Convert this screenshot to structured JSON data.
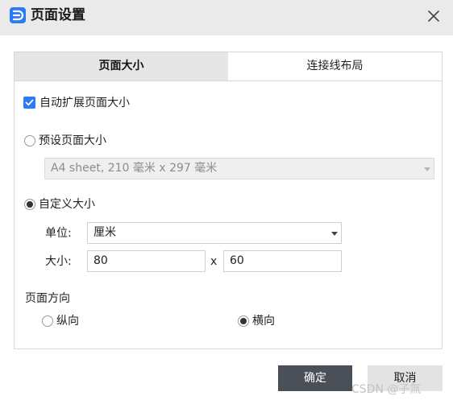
{
  "window": {
    "title": "页面设置"
  },
  "tabs": [
    {
      "label": "页面大小",
      "active": true
    },
    {
      "label": "连接线布局",
      "active": false
    }
  ],
  "auto_expand": {
    "label": "自动扩展页面大小",
    "checked": true
  },
  "preset": {
    "label": "预设页面大小",
    "selected": false,
    "dropdown_value": "A4 sheet, 210 毫米 x 297 毫米"
  },
  "custom": {
    "label": "自定义大小",
    "selected": true,
    "unit_label": "单位:",
    "unit_value": "厘米",
    "size_label": "大小:",
    "width_value": "80",
    "separator": "x",
    "height_value": "60"
  },
  "orientation": {
    "title": "页面方向",
    "portrait": {
      "label": "纵向",
      "selected": false
    },
    "landscape": {
      "label": "横向",
      "selected": true
    }
  },
  "buttons": {
    "ok": "确定",
    "cancel": "取消"
  },
  "watermark": "CSDN @子氚",
  "colors": {
    "accent": "#2a7cf6",
    "ok_button": "#4a4f58",
    "title_bar": "#eaeaea"
  },
  "icons": {
    "app": "app-logo-icon",
    "close": "close-icon",
    "check": "checkmark-icon"
  }
}
